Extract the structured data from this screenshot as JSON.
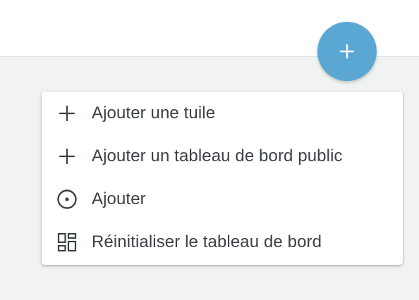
{
  "fab": {
    "icon": "plus-icon",
    "color": "#5ba7d4"
  },
  "menu": {
    "items": [
      {
        "label": "Ajouter une tuile",
        "icon": "plus-icon"
      },
      {
        "label": "Ajouter un tableau de bord public",
        "icon": "plus-icon"
      },
      {
        "label": "Ajouter",
        "icon": "circle-dot-icon"
      },
      {
        "label": "Réinitialiser le tableau de bord",
        "icon": "dashboard-layout-icon"
      }
    ]
  }
}
